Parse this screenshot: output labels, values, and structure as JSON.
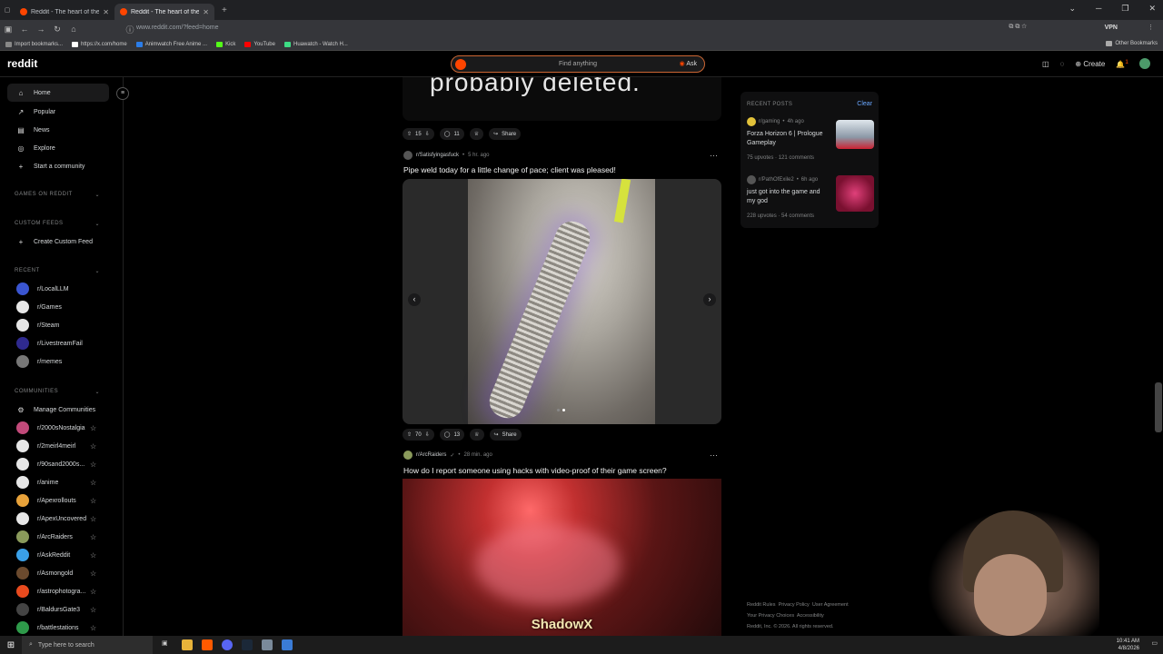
{
  "browser": {
    "tabs": [
      {
        "title": "Reddit - The heart of the intern",
        "active": false
      },
      {
        "title": "Reddit - The heart of the intern",
        "active": true
      }
    ],
    "url": "www.reddit.com/?feed=home",
    "vpn_label": "VPN",
    "bookmarks": [
      {
        "label": "Import bookmarks...",
        "color": "#888888"
      },
      {
        "label": "https://x.com/home",
        "color": "#ffffff"
      },
      {
        "label": "Animwatch Free Anime ...",
        "color": "#2b7de9"
      },
      {
        "label": "Kick",
        "color": "#53fc18"
      },
      {
        "label": "YouTube",
        "color": "#ff0000"
      },
      {
        "label": "Huawatch - Watch H...",
        "color": "#3ddc84"
      }
    ],
    "other_bookmarks": "Other Bookmarks"
  },
  "header": {
    "logo": "reddit",
    "search_placeholder": "Find anything",
    "ask_label": "Ask",
    "create_label": "Create",
    "notification_count": "1"
  },
  "sidebar": {
    "nav": [
      {
        "label": "Home",
        "icon": "home-icon",
        "glyph": "⌂"
      },
      {
        "label": "Popular",
        "icon": "popular-icon",
        "glyph": "↗"
      },
      {
        "label": "News",
        "icon": "news-icon",
        "glyph": "▤"
      },
      {
        "label": "Explore",
        "icon": "explore-icon",
        "glyph": "◎"
      },
      {
        "label": "Start a community",
        "icon": "plus-icon",
        "glyph": "+"
      }
    ],
    "games_heading": "GAMES ON REDDIT",
    "custom_feeds_heading": "CUSTOM FEEDS",
    "create_custom_feed": "Create Custom Feed",
    "recent_heading": "RECENT",
    "recent": [
      {
        "label": "r/LocalLLM",
        "color": "#3a55d1"
      },
      {
        "label": "r/Games",
        "color": "#e6e6e6"
      },
      {
        "label": "r/Steam",
        "color": "#e6e6e6"
      },
      {
        "label": "r/LivestreamFail",
        "color": "#2f2a8f"
      },
      {
        "label": "r/memes",
        "color": "#777777"
      }
    ],
    "communities_heading": "COMMUNITIES",
    "manage_communities": "Manage Communities",
    "communities": [
      {
        "label": "r/2000sNostalgia",
        "color": "#c24a7a"
      },
      {
        "label": "r/2meirl4meirl",
        "color": "#e6e6e6"
      },
      {
        "label": "r/90sand2000s...",
        "color": "#e6e6e6"
      },
      {
        "label": "r/anime",
        "color": "#e6e6e6"
      },
      {
        "label": "r/Apexrollouts",
        "color": "#e8a23a"
      },
      {
        "label": "r/ApexUncovered",
        "color": "#e6e6e6"
      },
      {
        "label": "r/ArcRaiders",
        "color": "#8a9a5b"
      },
      {
        "label": "r/AskReddit",
        "color": "#3aa0e8"
      },
      {
        "label": "r/Asmongold",
        "color": "#6b4a2e"
      },
      {
        "label": "r/astrophotogra...",
        "color": "#e84a1e"
      },
      {
        "label": "r/BaldursGate3",
        "color": "#444444"
      },
      {
        "label": "r/battlestations",
        "color": "#2e9a4a"
      }
    ]
  },
  "feed": {
    "previous_post": {
      "media_text": "probably deleted.",
      "upvotes": "15",
      "comments": "11",
      "share": "Share"
    },
    "post1": {
      "subreddit": "r/Satisfyingasfuck",
      "age": "5 hr. ago",
      "title": "Pipe weld today for a little change of pace; client was pleased!",
      "upvotes": "70",
      "comments": "13",
      "share": "Share"
    },
    "post2": {
      "subreddit": "r/ArcRaiders",
      "age": "28 min. ago",
      "title": "How do I report someone using hacks with video-proof of their game screen?",
      "overlay_text": "ShadowX"
    }
  },
  "recent_posts": {
    "heading": "RECENT POSTS",
    "clear": "Clear",
    "items": [
      {
        "sub": "r/gaming",
        "age": "4h ago",
        "title": "Forza Horizon 6 | Prologue Gameplay",
        "upvotes": "75 upvotes",
        "comments": "121 comments",
        "thumb": "#b9c4cf"
      },
      {
        "sub": "r/PathOfExile2",
        "age": "6h ago",
        "title": "just got into the game and my god",
        "upvotes": "228 upvotes",
        "comments": "54 comments",
        "thumb": "#a0213a"
      }
    ]
  },
  "footer": {
    "line1": [
      "Reddit Rules",
      "Privacy Policy",
      "User Agreement"
    ],
    "line2": [
      "Your Privacy Choices",
      "Accessibility"
    ],
    "copyright": "Reddit, Inc. © 2026. All rights reserved."
  },
  "taskbar": {
    "search_placeholder": "Type here to search",
    "time": "10:41 AM",
    "date": "4/8/2026"
  }
}
